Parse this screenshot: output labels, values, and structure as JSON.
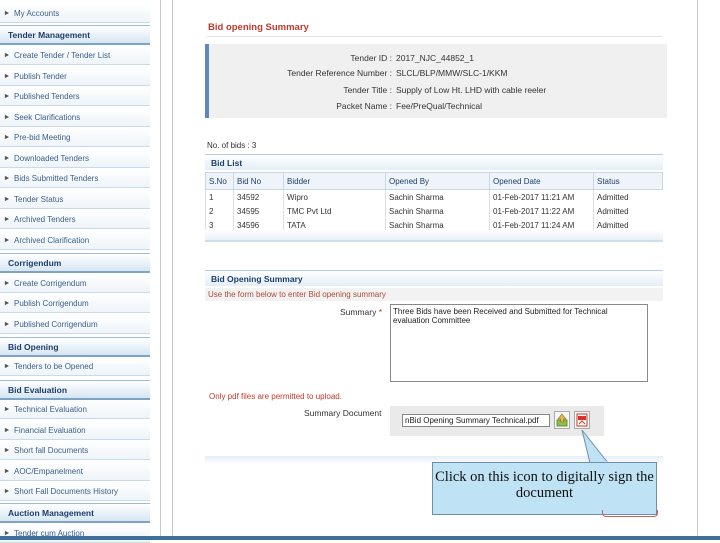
{
  "sidebar": {
    "items": [
      {
        "kind": "item",
        "label": "My Accounts"
      },
      {
        "kind": "head",
        "label": "Tender Management"
      },
      {
        "kind": "item",
        "label": "Create Tender / Tender List"
      },
      {
        "kind": "item",
        "label": "Publish Tender"
      },
      {
        "kind": "item",
        "label": "Published Tenders"
      },
      {
        "kind": "item",
        "label": "Seek Clarifications"
      },
      {
        "kind": "item",
        "label": "Pre-bid Meeting"
      },
      {
        "kind": "item",
        "label": "Downloaded Tenders"
      },
      {
        "kind": "item",
        "label": "Bids Submitted Tenders"
      },
      {
        "kind": "item",
        "label": "Tender Status"
      },
      {
        "kind": "item",
        "label": "Archived Tenders"
      },
      {
        "kind": "item",
        "label": "Archived Clarification"
      },
      {
        "kind": "head",
        "label": "Corrigendum"
      },
      {
        "kind": "item",
        "label": "Create Corrigendum"
      },
      {
        "kind": "item",
        "label": "Publish Corrigendum"
      },
      {
        "kind": "item",
        "label": "Published Corrigendum"
      },
      {
        "kind": "head",
        "label": "Bid Opening"
      },
      {
        "kind": "item",
        "label": "Tenders to be Opened"
      },
      {
        "kind": "head",
        "label": "Bid Evaluation"
      },
      {
        "kind": "item",
        "label": "Technical Evaluation"
      },
      {
        "kind": "item",
        "label": "Financial Evaluation"
      },
      {
        "kind": "item",
        "label": "Short fall Documents"
      },
      {
        "kind": "item",
        "label": "AOC/Empanelment"
      },
      {
        "kind": "item",
        "label": "Short Fall Documents History"
      },
      {
        "kind": "head",
        "label": "Auction Management"
      },
      {
        "kind": "item",
        "label": "Tender cum Auction"
      }
    ]
  },
  "page": {
    "title": "Bid opening Summary"
  },
  "tender_info": [
    {
      "key": "Tender ID :",
      "value": "2017_NJC_44852_1"
    },
    {
      "key": "Tender Reference Number :",
      "value": "SLCL/BLP/MMW/SLC-1/KKM"
    },
    {
      "key": "Tender Title :",
      "value": "Supply of Low Ht. LHD with cable reeler"
    },
    {
      "key": "Packet Name :",
      "value": "Fee/PreQual/Technical"
    }
  ],
  "no_of_bids": "No. of bids : 3",
  "bid_list": {
    "heading": "Bid List",
    "columns": [
      "S.No",
      "Bid No",
      "Bidder",
      "Opened By",
      "Opened Date",
      "Status"
    ],
    "rows": [
      [
        "1",
        "34592",
        "Wipro",
        "Sachin Sharma",
        "01-Feb-2017 11:21 AM",
        "Admitted"
      ],
      [
        "2",
        "34595",
        "TMC Pvt Ltd",
        "Sachin Sharma",
        "01-Feb-2017 11:22 AM",
        "Admitted"
      ],
      [
        "3",
        "34596",
        "TATA",
        "Sachin Sharma",
        "01-Feb-2017 11:24 AM",
        "Admitted"
      ]
    ]
  },
  "opening_summary": {
    "heading": "Bid Opening Summary",
    "hint": "Use the form below to enter Bid opening summary",
    "summary_label": "Summary",
    "required_mark": "*",
    "summary_text": "Three Bids have been Received and Submitted for Technical evaluation Committee",
    "pdf_note": "Only pdf files are permitted to upload.",
    "doc_label": "Summary Document",
    "doc_file": "nBid Opening Summary Technical.pdf"
  },
  "callout": {
    "text": "Click on this icon to digitally sign the document"
  },
  "colors": {
    "accent": "#1d3d6b",
    "title_red": "#c0392b",
    "callout_bg": "#bfe3f4"
  }
}
